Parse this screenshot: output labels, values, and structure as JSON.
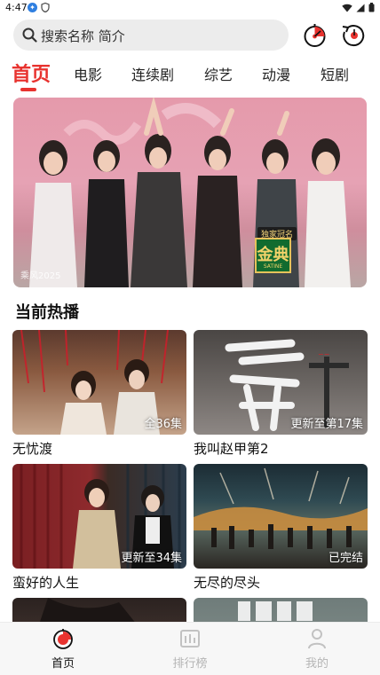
{
  "status_bar": {
    "time": "4:47"
  },
  "search": {
    "placeholder": "搜索名称 简介"
  },
  "tabs": [
    {
      "label": "首页",
      "active": true
    },
    {
      "label": "电影"
    },
    {
      "label": "连续剧"
    },
    {
      "label": "综艺"
    },
    {
      "label": "动漫"
    },
    {
      "label": "短剧"
    }
  ],
  "banner": {
    "caption": "乘风2025",
    "badge_top": "独家冠名",
    "badge_main": "金典",
    "badge_sub": "SATINE"
  },
  "section": {
    "title": "当前热播"
  },
  "cards": [
    {
      "title": "无忧渡",
      "badge": "全36集"
    },
    {
      "title": "我叫赵甲第2",
      "badge": "更新至第17集"
    },
    {
      "title": "蛮好的人生",
      "badge": "更新至34集"
    },
    {
      "title": "无尽的尽头",
      "badge": "已完结"
    },
    {
      "title": "",
      "badge": ""
    },
    {
      "title": "",
      "badge": ""
    }
  ],
  "bottom_nav": {
    "home": "首页",
    "rank": "排行榜",
    "mine": "我的"
  },
  "colors": {
    "accent": "#e8332f"
  }
}
